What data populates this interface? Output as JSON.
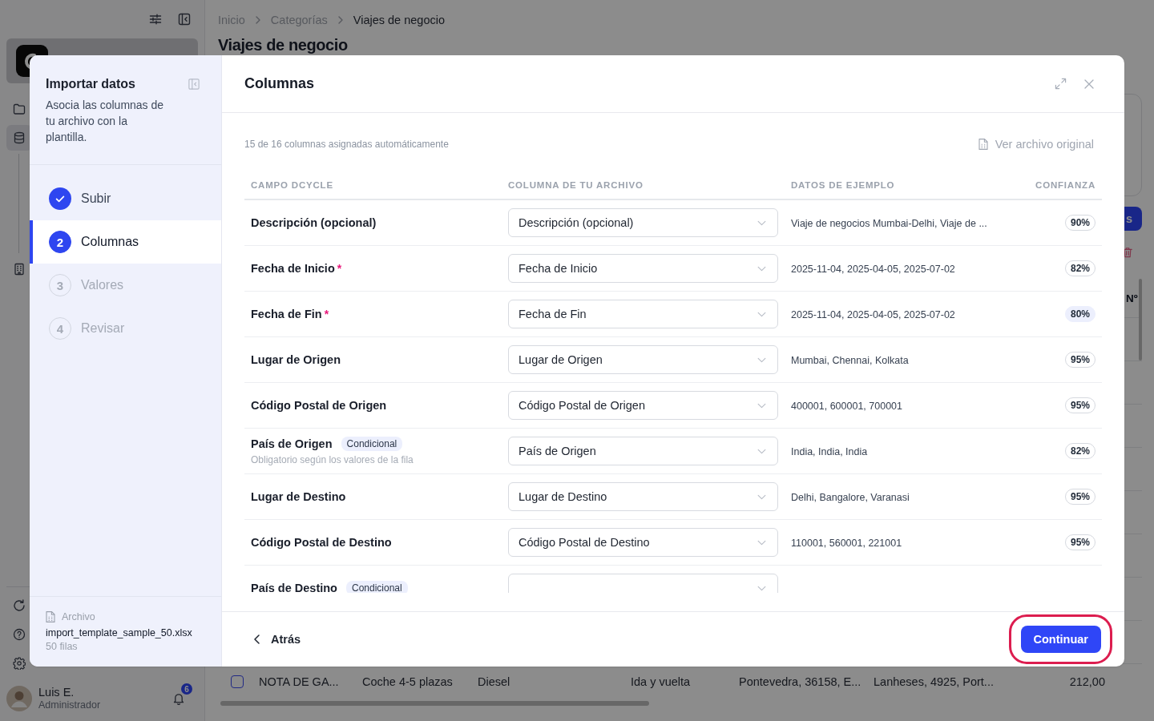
{
  "app": {
    "sidebar": {
      "nav_items": [
        {
          "selected": false
        },
        {
          "selected": true
        },
        {
          "selected": false
        }
      ],
      "user": {
        "name": "Luis E.",
        "role": "Administrador",
        "notifications": "6"
      }
    },
    "breadcrumbs": [
      {
        "label": "Inicio",
        "current": false
      },
      {
        "label": "Categorías",
        "current": false
      },
      {
        "label": "Viajes de negocio",
        "current": true
      }
    ],
    "title": "Viajes de negocio",
    "action_button": "s",
    "table": {
      "column_header": "Nº",
      "rows": [
        {
          "checked": false,
          "cells": [
            "NOTA DE GA...",
            "Coche 4-5 plazas",
            "Diesel",
            "Ida y vuelta",
            "Pontevedra, 36158, E...",
            "Lanheses, 4925, Port...",
            "212,00"
          ]
        }
      ]
    }
  },
  "dialog": {
    "title": "Importar datos",
    "description": "Asocia las columnas de tu archivo con la plantilla.",
    "steps": [
      {
        "label": "Subir",
        "completed": true,
        "selected": false
      },
      {
        "number": "2",
        "label": "Columnas",
        "completed": false,
        "selected": true
      },
      {
        "number": "3",
        "label": "Valores",
        "completed": false,
        "selected": false
      },
      {
        "number": "4",
        "label": "Revisar",
        "completed": false,
        "selected": false
      }
    ],
    "file": {
      "label": "Archivo",
      "name": "import_template_sample_50.xlsx",
      "rows": "50 filas"
    },
    "panel_title": "Columnas",
    "summary": "15 de 16 columnas asignadas automáticamente",
    "view_original": "Ver archivo original",
    "columns": [
      "CAMPO DCYCLE",
      "COLUMNA DE TU ARCHIVO",
      "DATOS DE EJEMPLO",
      "CONFIANZA"
    ],
    "mappings": [
      {
        "field": "Descripción (opcional)",
        "column": "Descripción (opcional)",
        "sample": "Viaje de negocios Mumbai-Delhi, Viaje de ...",
        "confidence": "90%",
        "confidence_highlighted": false
      },
      {
        "field": "Fecha de Inicio",
        "required_mark": "*",
        "column": "Fecha de Inicio",
        "sample": "2025-11-04, 2025-04-05, 2025-07-02",
        "confidence": "82%",
        "confidence_highlighted": false
      },
      {
        "field": "Fecha de Fin",
        "required_mark": "*",
        "column": "Fecha de Fin",
        "sample": "2025-11-04, 2025-04-05, 2025-07-02",
        "confidence": "80%",
        "confidence_highlighted": true
      },
      {
        "field": "Lugar de Origen",
        "column": "Lugar de Origen",
        "sample": "Mumbai, Chennai, Kolkata",
        "confidence": "95%",
        "confidence_highlighted": false
      },
      {
        "field": "Código Postal de Origen",
        "column": "Código Postal de Origen",
        "sample": "400001, 600001, 700001",
        "confidence": "95%",
        "confidence_highlighted": false
      },
      {
        "field": "País de Origen",
        "badge": "Condicional",
        "hint": "Obligatorio según los valores de la fila",
        "column": "País de Origen",
        "sample": "India, India, India",
        "confidence": "82%",
        "confidence_highlighted": false
      },
      {
        "field": "Lugar de Destino",
        "column": "Lugar de Destino",
        "sample": "Delhi, Bangalore, Varanasi",
        "confidence": "95%",
        "confidence_highlighted": false
      },
      {
        "field": "Código Postal de Destino",
        "column": "Código Postal de Destino",
        "sample": "110001, 560001, 221001",
        "confidence": "95%",
        "confidence_highlighted": false
      },
      {
        "field": "País de Destino",
        "badge": "Condicional"
      }
    ],
    "back": "Atrás",
    "continue": {
      "label": "Continuar",
      "annotated": true
    }
  }
}
